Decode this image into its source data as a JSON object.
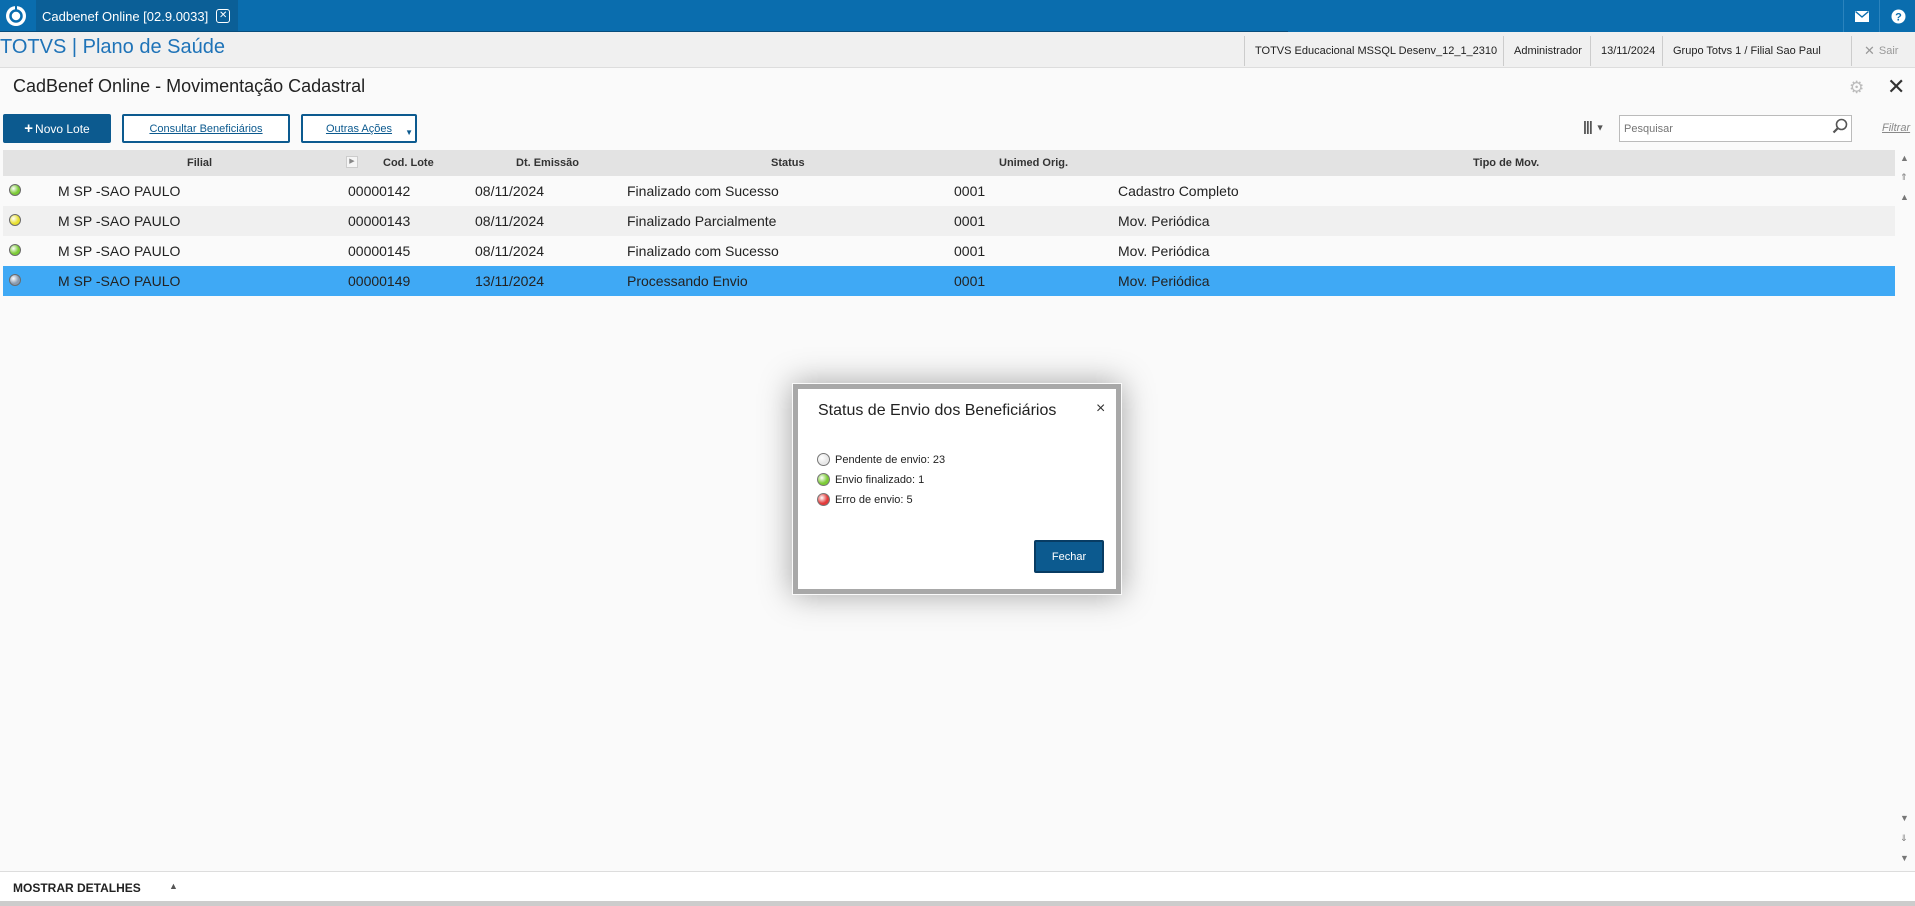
{
  "topbar": {
    "tab_label": "Cadbenef Online [02.9.0033]",
    "tab_close": "✕",
    "icons": [
      "mail-icon",
      "help-icon"
    ],
    "color": "#0a6dae"
  },
  "header": {
    "brand": "TOTVS | Plano de Saúde",
    "environment": "TOTVS Educacional MSSQL Desenv_12_1_2310",
    "user": "Administrador",
    "date": "13/11/2024",
    "company": "Grupo Totvs 1 / Filial Sao Paul",
    "exit": "Sair"
  },
  "page": {
    "title": "CadBenef Online - Movimentação Cadastral",
    "close": "✕"
  },
  "toolbar": {
    "new_batch": "Novo Lote",
    "consult": "Consultar Beneficiários",
    "other": "Outras Ações",
    "search_placeholder": "Pesquisar",
    "filter": "Filtrar"
  },
  "grid": {
    "columns": [
      "Filial",
      "Cod. Lote",
      "Dt. Emissão",
      "Status",
      "Unimed Orig.",
      "Tipo de Mov."
    ],
    "rows": [
      {
        "status_color": "#7ccb36",
        "filial": "M SP -SAO PAULO",
        "lote": "00000142",
        "data": "08/11/2024",
        "status": "Finalizado com Sucesso",
        "unimed": "0001",
        "tipo": "Cadastro Completo"
      },
      {
        "status_color": "#e8e030",
        "filial": "M SP -SAO PAULO",
        "lote": "00000143",
        "data": "08/11/2024",
        "status": "Finalizado Parcialmente",
        "unimed": "0001",
        "tipo": "Mov. Periódica"
      },
      {
        "status_color": "#7ccb36",
        "filial": "M SP -SAO PAULO",
        "lote": "00000145",
        "data": "08/11/2024",
        "status": "Finalizado com Sucesso",
        "unimed": "0001",
        "tipo": "Mov. Periódica"
      },
      {
        "status_color": "#8a9bb0",
        "filial": "M SP -SAO PAULO",
        "lote": "00000149",
        "data": "13/11/2024",
        "status": "Processando Envio",
        "unimed": "0001",
        "tipo": "Mov. Periódica"
      }
    ]
  },
  "footer": {
    "label": "MOSTRAR DETALHES"
  },
  "modal": {
    "title": "Status de Envio dos Beneficiários",
    "close": "×",
    "items": [
      {
        "label": "Pendente de envio: 23",
        "color": "#e8e8e8"
      },
      {
        "label": "Envio finalizado: 1",
        "color": "#7ccb36"
      },
      {
        "label": "Erro de envio: 5",
        "color": "#e23b3b"
      }
    ],
    "button": "Fechar"
  }
}
